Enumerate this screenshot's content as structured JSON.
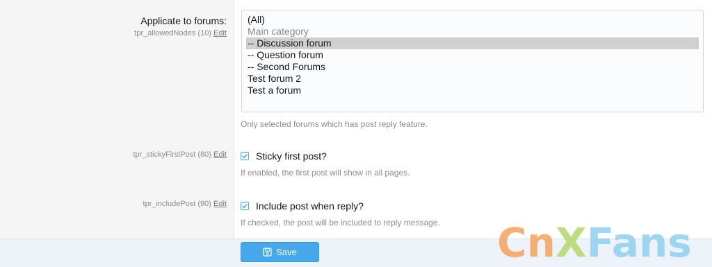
{
  "fields": {
    "allowed_nodes": {
      "label": "Applicate to forums:",
      "key": "tpr_allowedNodes (10)",
      "edit_label": "Edit",
      "options": [
        {
          "text": "(All)",
          "group": false,
          "selected": false
        },
        {
          "text": "Main category",
          "group": true,
          "selected": false
        },
        {
          "text": "-- Discussion forum",
          "group": false,
          "selected": true
        },
        {
          "text": "-- Question forum",
          "group": false,
          "selected": false
        },
        {
          "text": "-- Second Forums",
          "group": false,
          "selected": false
        },
        {
          "text": "Test forum 2",
          "group": false,
          "selected": false
        },
        {
          "text": "Test a forum",
          "group": false,
          "selected": false
        }
      ],
      "hint": "Only selected forums which has post reply feature."
    },
    "sticky_first_post": {
      "key": "tpr_stickyFirstPost (80)",
      "edit_label": "Edit",
      "checkbox_label": "Sticky first post?",
      "checked": true,
      "hint": "If enabled, the first post will show in all pages."
    },
    "include_post": {
      "key": "tpr_includePost (90)",
      "edit_label": "Edit",
      "checkbox_label": "Include post when reply?",
      "checked": true,
      "hint": "If checked, the post will be included to reply message."
    }
  },
  "footer": {
    "save_label": "Save",
    "save_icon": "floppy-disk-icon"
  },
  "watermark": {
    "text": "CnXFans",
    "colors": [
      "#f5a35c",
      "#f5a35c",
      "#b4d86a",
      "#8fd0ef",
      "#8fd0ef",
      "#8fd0ef",
      "#8fd0ef"
    ]
  },
  "colors": {
    "accent": "#47a7eb",
    "selection": "#cfcfcf",
    "hint_text": "#8c8c8c",
    "label_bg": "#f5f5f5",
    "footer_bg": "#edf3f8"
  }
}
